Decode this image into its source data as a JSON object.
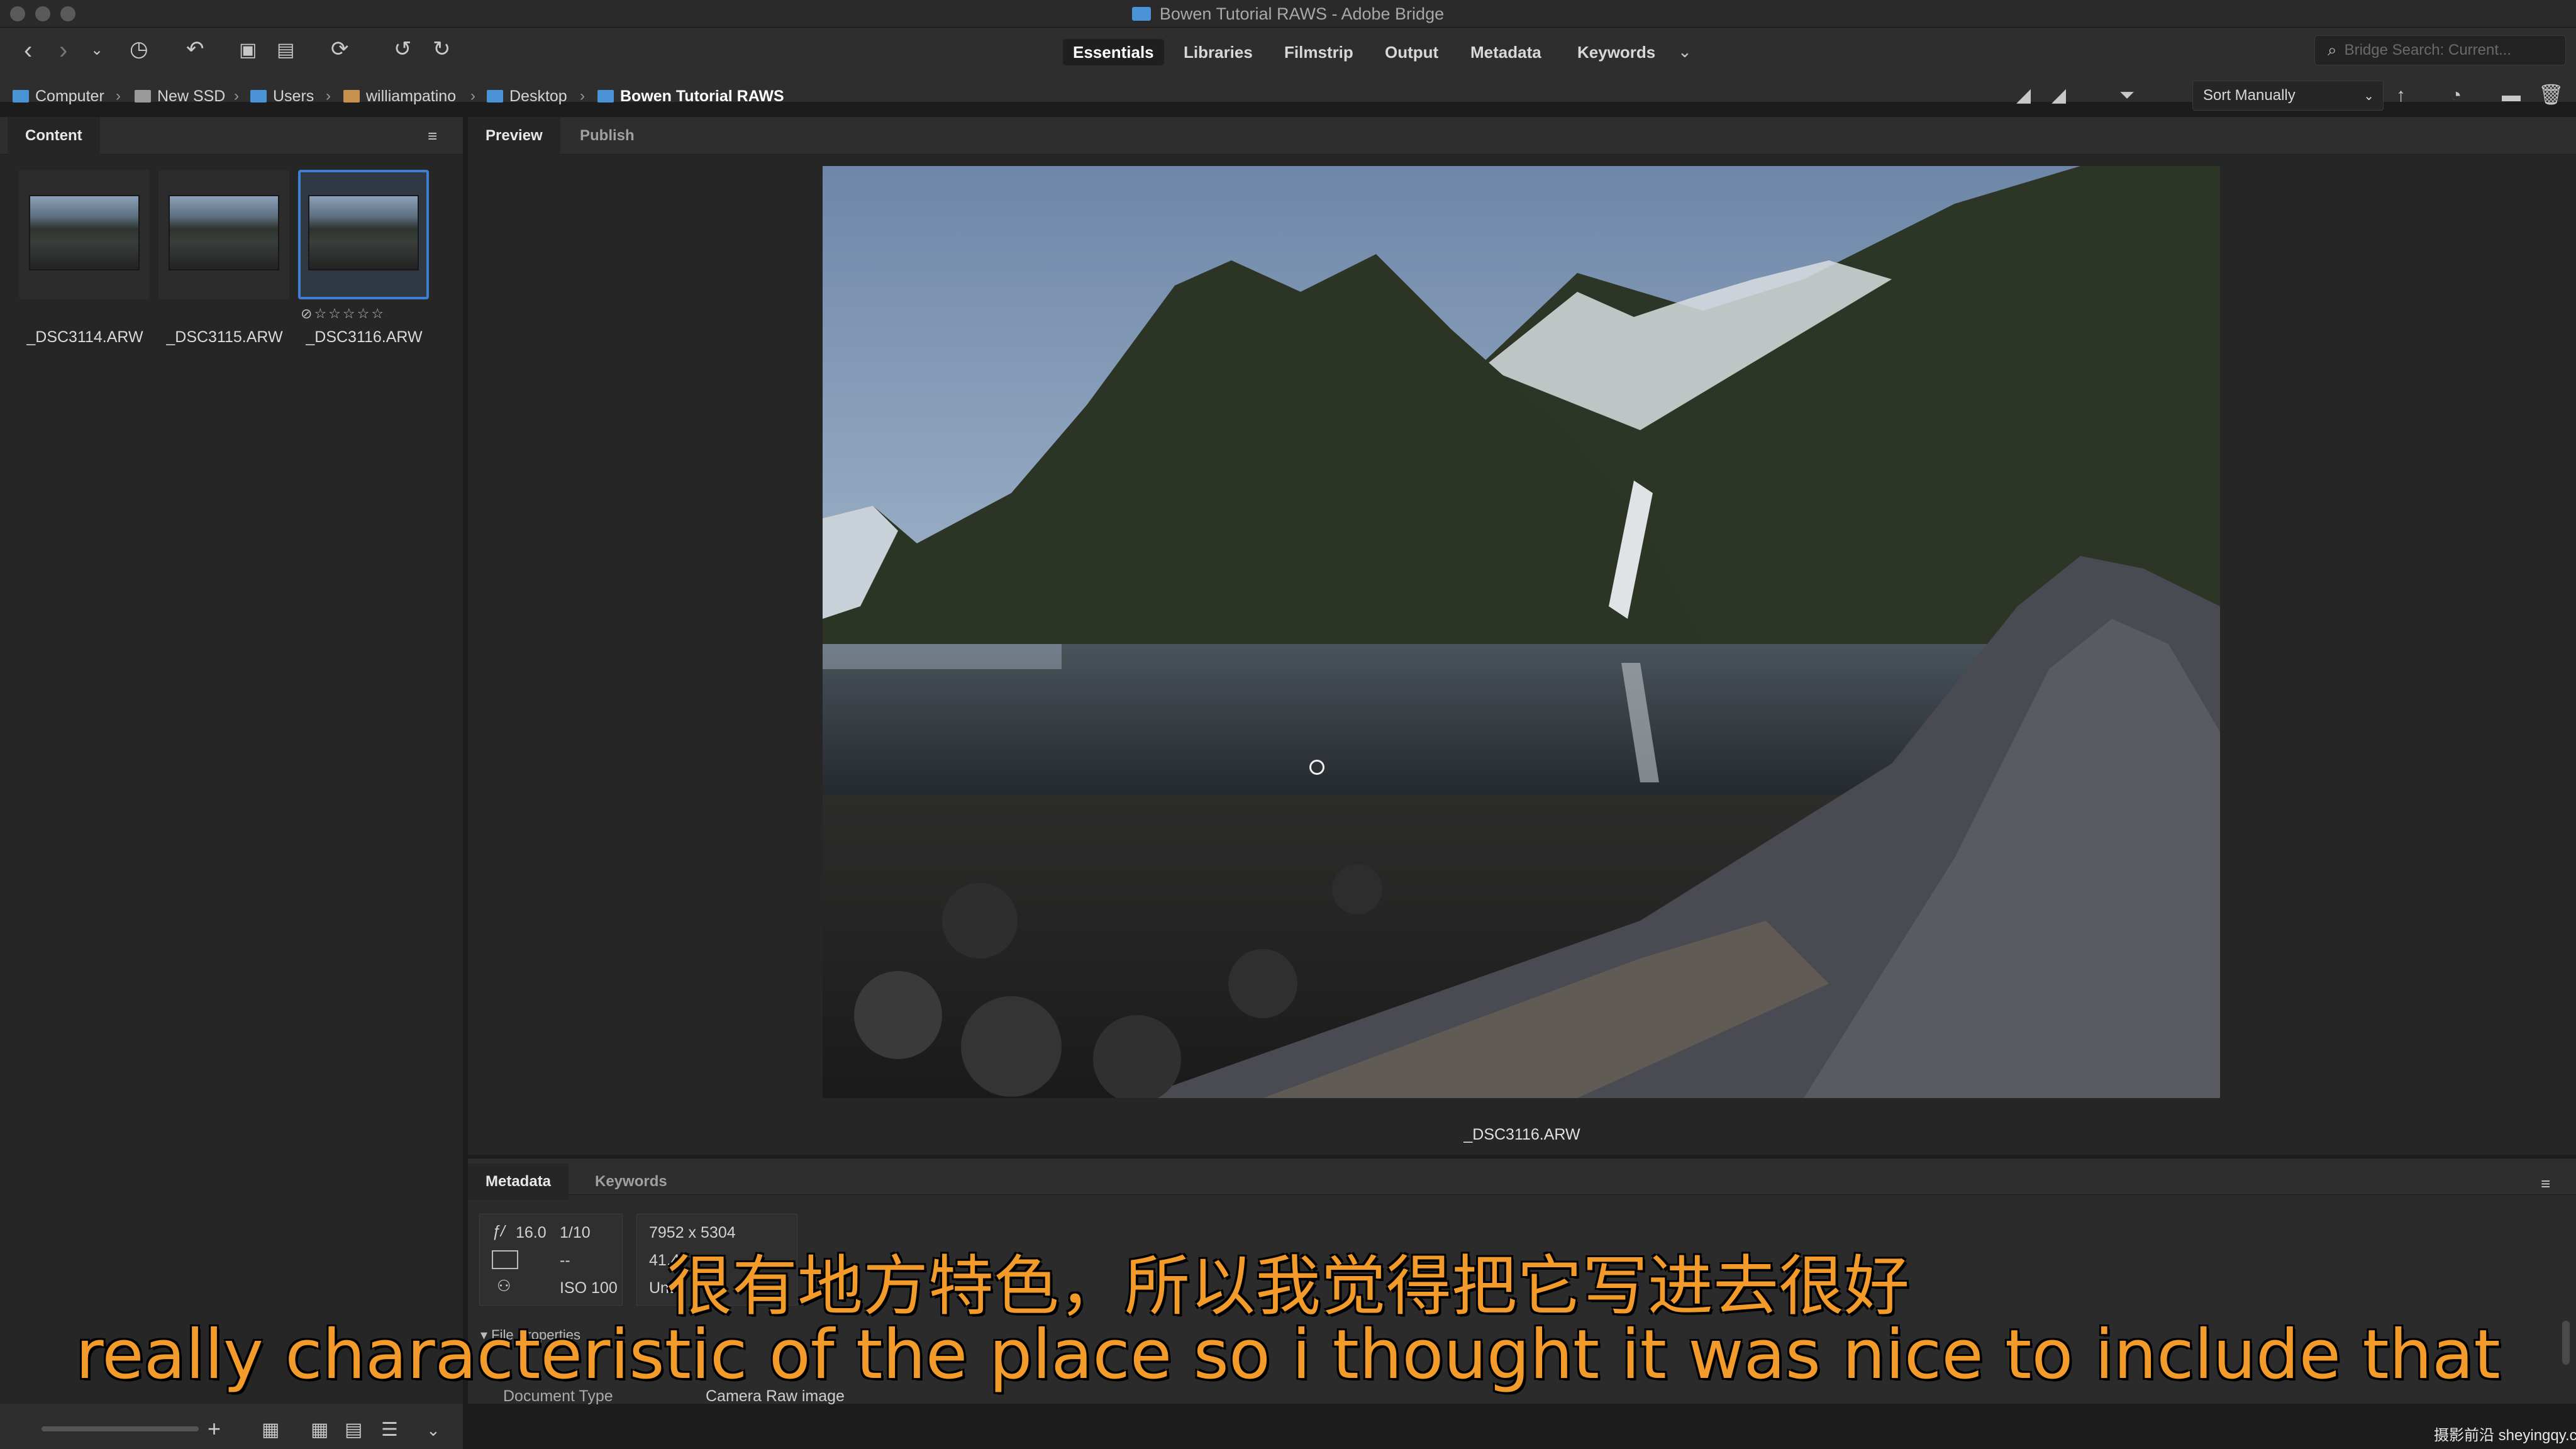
{
  "window": {
    "title": "Bowen Tutorial RAWS - Adobe Bridge"
  },
  "workspaces": [
    "Essentials",
    "Libraries",
    "Filmstrip",
    "Output",
    "Metadata",
    "Keywords"
  ],
  "search": {
    "placeholder": "Bridge Search: Current..."
  },
  "breadcrumb": [
    "Computer",
    "New SSD",
    "Users",
    "williampatino",
    "Desktop",
    "Bowen Tutorial RAWS"
  ],
  "sort": {
    "label": "Sort Manually"
  },
  "content_panel": {
    "tab": "Content"
  },
  "thumbnails": [
    {
      "name": "_DSC3114.ARW"
    },
    {
      "name": "_DSC3115.ARW"
    },
    {
      "name": "_DSC3116.ARW",
      "rating_glyphs": "☆☆☆☆☆"
    }
  ],
  "preview_tabs": [
    "Preview",
    "Publish"
  ],
  "preview": {
    "filename": "_DSC3116.ARW"
  },
  "metadata_tabs": [
    "Metadata",
    "Keywords"
  ],
  "metadata": {
    "aperture": "16.0",
    "shutter": "1/10",
    "metering": "--",
    "iso": "ISO 100",
    "dimensions": "7952 x 5304",
    "size_partial": "41.4",
    "color_partial": "Unt",
    "section_title": "File Properties",
    "doc_type_label": "Document Type",
    "doc_type_value": "Camera Raw image"
  },
  "subtitles": {
    "zh": "很有地方特色，所以我觉得把它写进去很好",
    "en": "really characteristic of the place so i thought it was nice to include that"
  },
  "watermark": "摄影前沿 sheyingqy.com",
  "colors": {
    "accent": "#3f7fd1",
    "subtitle": "#f29a2a"
  }
}
